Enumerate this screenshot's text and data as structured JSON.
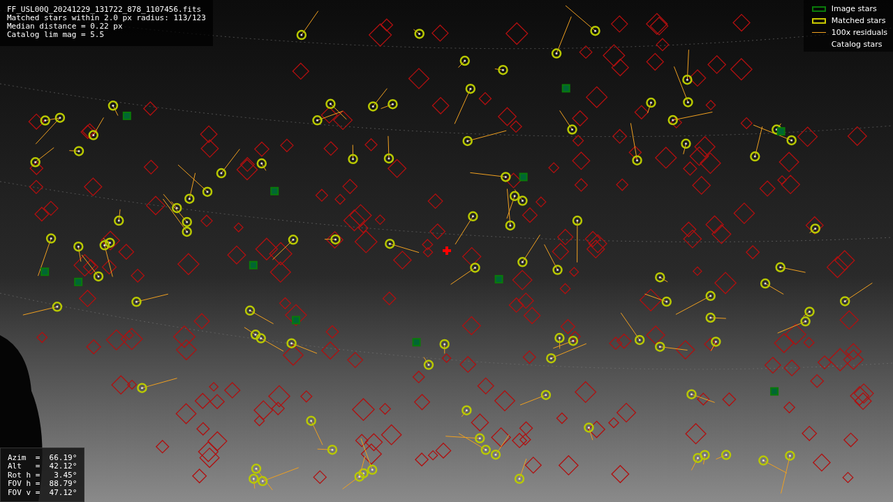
{
  "file_info": {
    "lines": [
      "FF_USL00Q_20241229_131722_878_1107456.fits",
      "Matched stars within 2.0 px radius: 113/123",
      "Median distance = 0.22 px",
      "Catalog lim mag = 5.5"
    ]
  },
  "legend": {
    "items": [
      {
        "kind": "image",
        "label": "Image stars"
      },
      {
        "kind": "matched",
        "label": "Matched stars"
      },
      {
        "kind": "residual",
        "label": "100x residuals"
      },
      {
        "kind": "catalog",
        "label": "Catalog stars"
      }
    ]
  },
  "pointing": {
    "lines": [
      "Azim  =  66.19°",
      "Alt   =  42.12°",
      "Rot h =   3.45°",
      "FOV h =  88.79°",
      "FOV v =  47.12°"
    ]
  }
}
